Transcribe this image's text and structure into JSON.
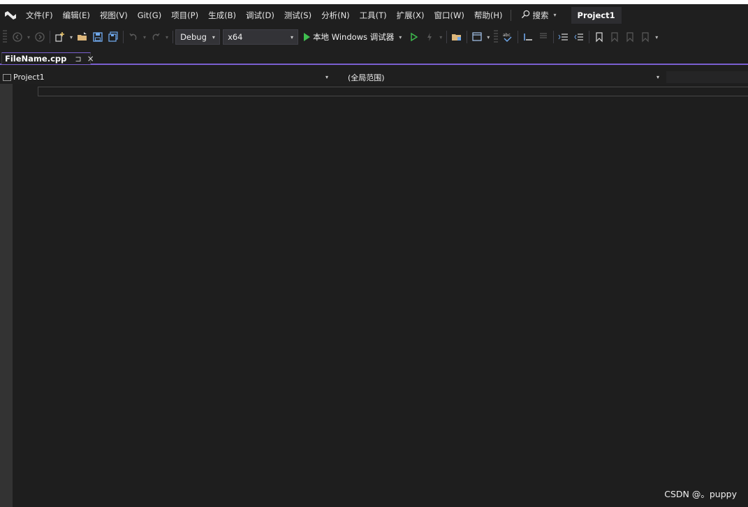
{
  "menu": {
    "items": [
      "文件(F)",
      "编辑(E)",
      "视图(V)",
      "Git(G)",
      "项目(P)",
      "生成(B)",
      "调试(D)",
      "测试(S)",
      "分析(N)",
      "工具(T)",
      "扩展(X)",
      "窗口(W)",
      "帮助(H)"
    ],
    "search_label": "搜索",
    "solution_name": "Project1"
  },
  "toolbar": {
    "configuration": "Debug",
    "platform": "x64",
    "run_label": "本地 Windows 调试器"
  },
  "tab": {
    "filename": "FileName.cpp",
    "pin_glyph": "⊐",
    "close_glyph": "×"
  },
  "navbar": {
    "project": "Project1",
    "scope": "(全局范围)"
  },
  "watermark": "CSDN @。puppy",
  "colors": {
    "accent": "#7a5fd0",
    "background": "#1f1f1f",
    "editor": "#1e1e1e",
    "run_green": "#3fbf4f"
  }
}
